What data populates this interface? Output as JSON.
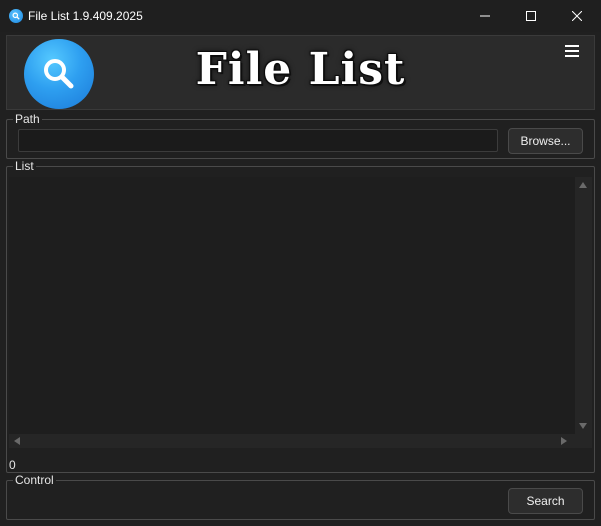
{
  "window": {
    "title": "File List 1.9.409.2025",
    "controls": [
      "minimize",
      "maximize",
      "close"
    ]
  },
  "header": {
    "title": "File List",
    "logo_icon": "search-icon",
    "menu_icon": "hamburger-menu-icon"
  },
  "path_group": {
    "label": "Path",
    "input_value": "",
    "browse_label": "Browse..."
  },
  "list_group": {
    "label": "List",
    "items": [],
    "count": "0"
  },
  "control_group": {
    "label": "Control",
    "search_label": "Search"
  },
  "colors": {
    "background": "#202020",
    "panel": "#2b2b2b",
    "accent": "#2e9ff0",
    "text": "#e6e6e6"
  }
}
